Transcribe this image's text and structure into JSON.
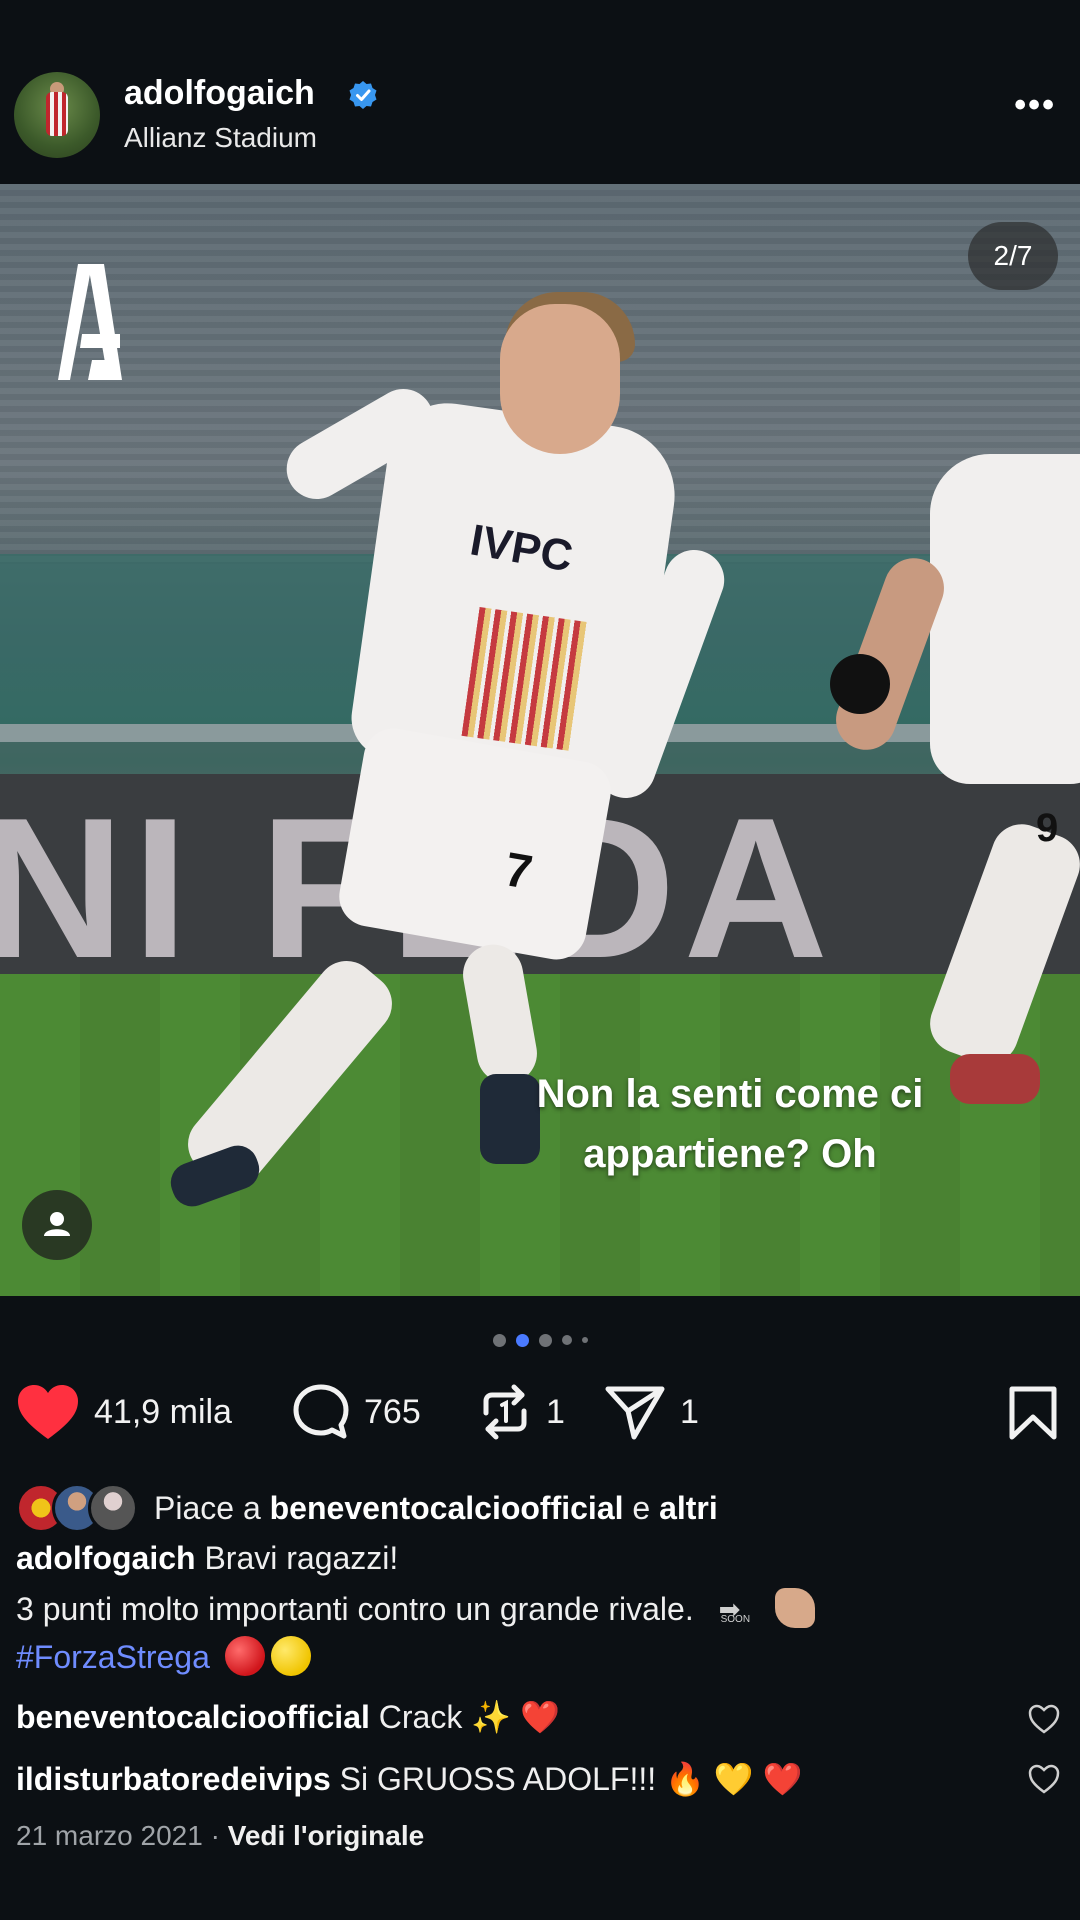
{
  "header": {
    "username": "adolfogaich",
    "location": "Allianz Stadium",
    "more_label": "•••"
  },
  "post": {
    "counter": "2/7",
    "caption_overlay_line1": "Non la senti come ci",
    "caption_overlay_line2": "appartiene? Oh",
    "board_text": "NI FEDA",
    "sponsor": "IVPC",
    "player_number": "7",
    "player2_number": "9",
    "carousel": {
      "total": 5,
      "active": 1
    }
  },
  "actions": {
    "likes": "41,9 mila",
    "comments": "765",
    "reposts": "1",
    "shares": "1"
  },
  "liked_by": {
    "prefix": "Piace a ",
    "user": "beneventocalcioofficial",
    "middle": " e ",
    "others": "altri"
  },
  "caption": {
    "user": "adolfogaich",
    "line1": " Bravi ragazzi!",
    "line2": " 3 punti molto importanti contro un grande rivale.",
    "hashtag": "#ForzaStrega",
    "soon_label": "SOON"
  },
  "comments": [
    {
      "user": "beneventocalcioofficial",
      "text": " Crack ✨ ❤️"
    },
    {
      "user": "ildisturbatoredeivips",
      "text": " Si GRUOSS ADOLF!!! 🔥 💛 ❤️"
    }
  ],
  "footer": {
    "date": "21 marzo 2021",
    "separator": " · ",
    "see_original": "Vedi l'originale"
  },
  "colors": {
    "background": "#0c1014",
    "like_red": "#ff3040",
    "hashtag_blue": "#6f8cff",
    "verified_blue": "#3897f0",
    "active_dot": "#4a7aff"
  }
}
